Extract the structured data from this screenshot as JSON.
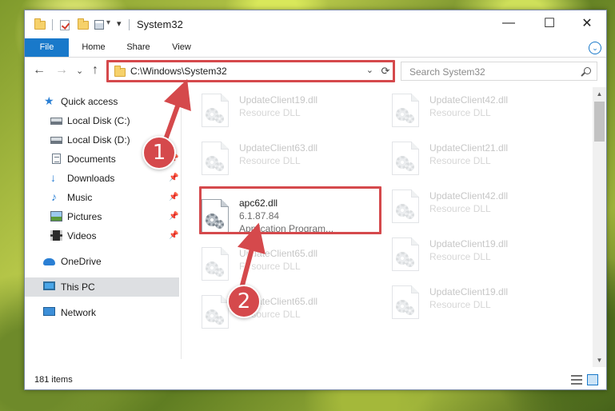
{
  "window": {
    "title": "System32",
    "minimize_glyph": "—",
    "maximize_glyph": "☐",
    "close_glyph": "✕",
    "dropdown_glyph": "▾"
  },
  "ribbon": {
    "tabs": [
      {
        "label": "File",
        "active": true
      },
      {
        "label": "Home",
        "active": false
      },
      {
        "label": "Share",
        "active": false
      },
      {
        "label": "View",
        "active": false
      }
    ],
    "expand_glyph": "⌄"
  },
  "address_bar": {
    "back_glyph": "←",
    "forward_glyph": "→",
    "recent_glyph": "⌄",
    "up_glyph": "↑",
    "path": "C:\\Windows\\System32",
    "dropdown_glyph": "⌄",
    "refresh_glyph": "⟳"
  },
  "search": {
    "placeholder": "Search System32",
    "icon": "search-icon"
  },
  "sidebar": {
    "items": [
      {
        "label": "Quick access",
        "icon": "star-icon",
        "pinned": false
      },
      {
        "label": "Local Disk (C:)",
        "icon": "drive-icon",
        "pinned": false
      },
      {
        "label": "Local Disk (D:)",
        "icon": "drive-icon",
        "pinned": false
      },
      {
        "label": "Documents",
        "icon": "document-icon",
        "pinned": true
      },
      {
        "label": "Downloads",
        "icon": "download-icon",
        "pinned": true
      },
      {
        "label": "Music",
        "icon": "music-icon",
        "pinned": true
      },
      {
        "label": "Pictures",
        "icon": "pictures-icon",
        "pinned": true
      },
      {
        "label": "Videos",
        "icon": "video-icon",
        "pinned": true
      },
      {
        "label": "OneDrive",
        "icon": "cloud-icon",
        "pinned": false
      },
      {
        "label": "This PC",
        "icon": "pc-icon",
        "pinned": false,
        "selected": true
      },
      {
        "label": "Network",
        "icon": "network-icon",
        "pinned": false
      }
    ],
    "pin_glyph": "📌"
  },
  "files": {
    "left_column": [
      {
        "name": "UpdateClient19.dll",
        "type": "Resource DLL"
      },
      {
        "name": "UpdateClient63.dll",
        "type": "Resource DLL"
      },
      {
        "name": "apc62.dll",
        "version": "6.1.87.84",
        "description": "Application Program...",
        "highlighted": true
      },
      {
        "name": "UpdateClient65.dll",
        "type": "Resource DLL"
      },
      {
        "name": "UpdateClient65.dll",
        "type": "Resource DLL"
      }
    ],
    "right_column": [
      {
        "name": "UpdateClient42.dll",
        "type": "Resource DLL"
      },
      {
        "name": "UpdateClient21.dll",
        "type": "Resource DLL"
      },
      {
        "name": "UpdateClient42.dll",
        "type": "Resource DLL"
      },
      {
        "name": "UpdateClient19.dll",
        "type": "Resource DLL"
      },
      {
        "name": "UpdateClient19.dll",
        "type": "Resource DLL"
      }
    ]
  },
  "scrollbar": {
    "up_glyph": "▲",
    "down_glyph": "▼"
  },
  "status": {
    "item_count": "181 items"
  },
  "callouts": {
    "step1": "1",
    "step2": "2",
    "accent": "#d5494c"
  }
}
